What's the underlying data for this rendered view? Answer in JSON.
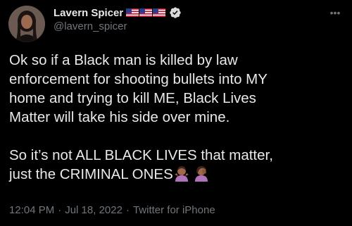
{
  "author": {
    "display_name": "Lavern Spicer",
    "handle": "@lavern_spicer",
    "flags": [
      "us-flag",
      "us-flag",
      "us-flag"
    ],
    "verified": true
  },
  "tweet": {
    "paragraph_1": "Ok so if a Black man is killed by law\nenforcement for shooting bullets into MY\nhome and trying to kill ME, Black Lives\nMatter will take his side over mine.",
    "paragraph_2": "So it’s not ALL BLACK LIVES that matter,\njust the CRIMINAL ONES",
    "trailing_emojis": [
      "person-shrugging-emoji",
      "person-facepalming-emoji"
    ]
  },
  "meta": {
    "time": "12:04 PM",
    "separator_1": "·",
    "date": "Jul 18, 2022",
    "separator_2": "·",
    "source": "Twitter for iPhone"
  },
  "more_label": "•••"
}
